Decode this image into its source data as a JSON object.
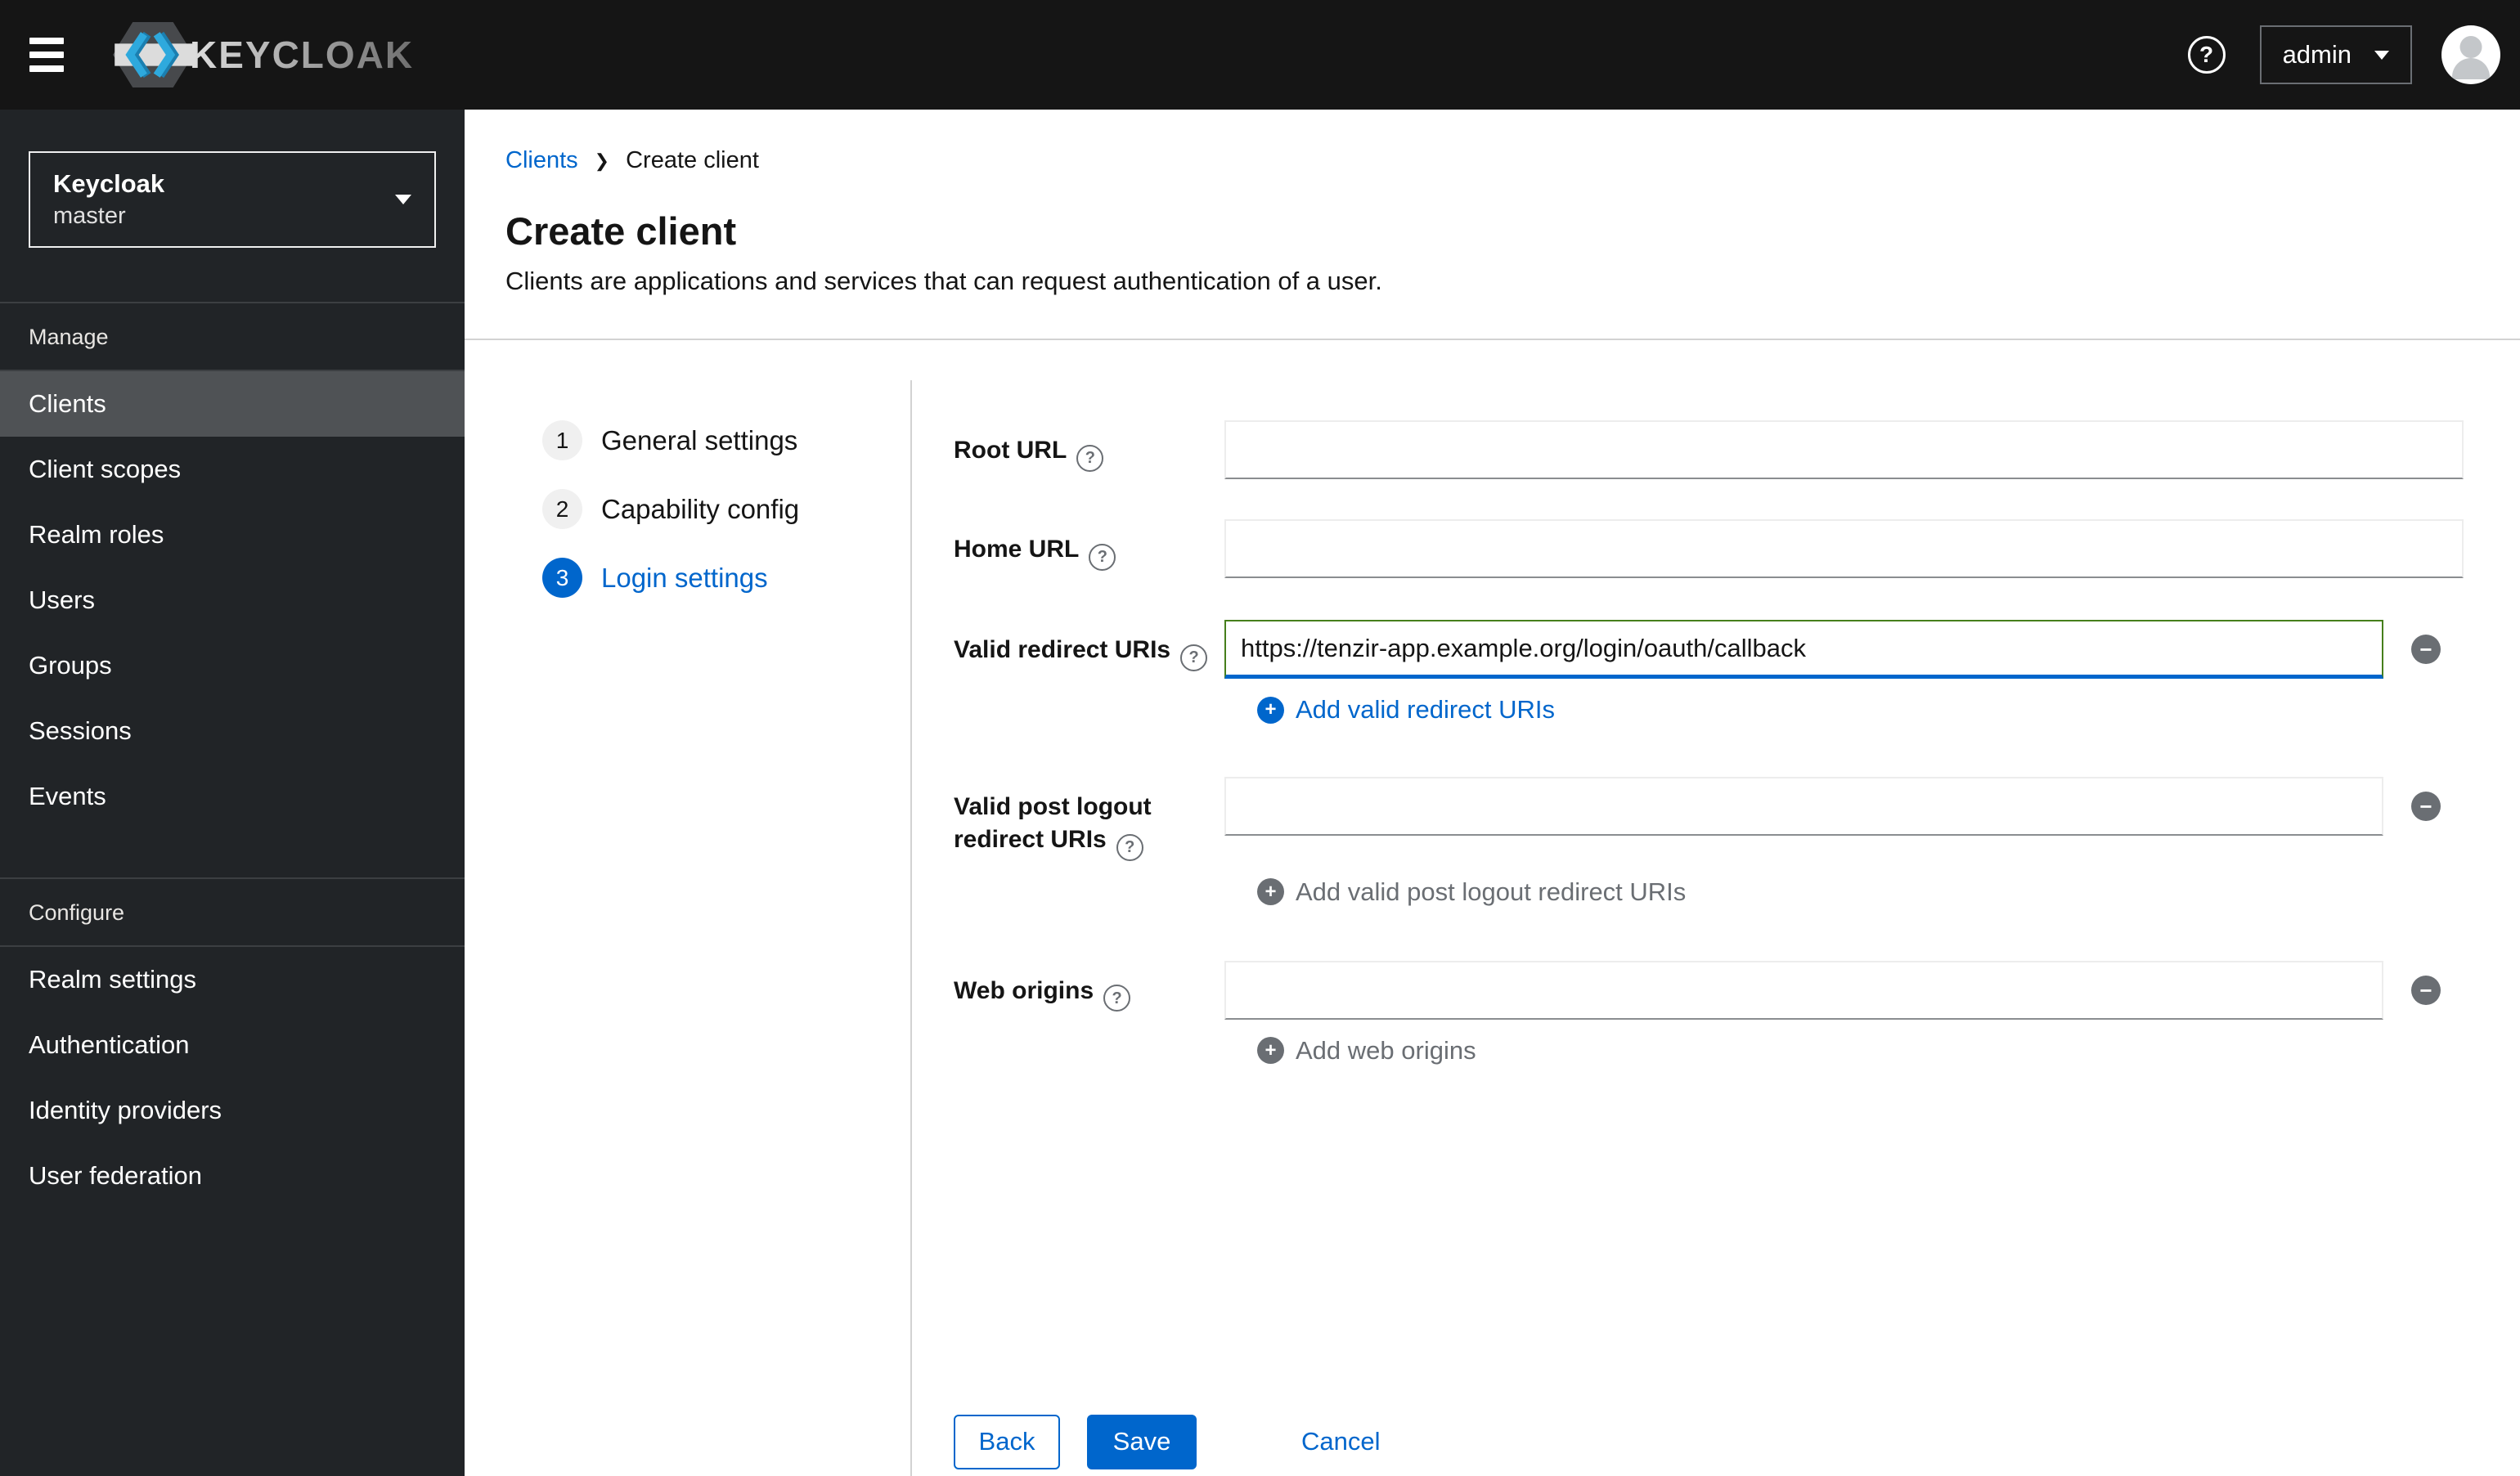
{
  "topbar": {
    "brand": "KEYCLOAK",
    "username": "admin"
  },
  "sidebar": {
    "realm": {
      "name": "Keycloak",
      "current": "master"
    },
    "sections": [
      {
        "label": "Manage",
        "items": [
          {
            "label": "Clients",
            "active": true
          },
          {
            "label": "Client scopes",
            "active": false
          },
          {
            "label": "Realm roles",
            "active": false
          },
          {
            "label": "Users",
            "active": false
          },
          {
            "label": "Groups",
            "active": false
          },
          {
            "label": "Sessions",
            "active": false
          },
          {
            "label": "Events",
            "active": false
          }
        ]
      },
      {
        "label": "Configure",
        "items": [
          {
            "label": "Realm settings",
            "active": false
          },
          {
            "label": "Authentication",
            "active": false
          },
          {
            "label": "Identity providers",
            "active": false
          },
          {
            "label": "User federation",
            "active": false
          }
        ]
      }
    ]
  },
  "breadcrumb": {
    "link": "Clients",
    "current": "Create client"
  },
  "page": {
    "title": "Create client",
    "subtitle": "Clients are applications and services that can request authentication of a user."
  },
  "wizard": {
    "steps": [
      {
        "num": "1",
        "label": "General settings",
        "active": false
      },
      {
        "num": "2",
        "label": "Capability config",
        "active": false
      },
      {
        "num": "3",
        "label": "Login settings",
        "active": true
      }
    ]
  },
  "form": {
    "fields": [
      {
        "label": "Root URL",
        "value": ""
      },
      {
        "label": "Home URL",
        "value": ""
      },
      {
        "label": "Valid redirect URIs",
        "value": "https://tenzir-app.example.org/login/oauth/callback",
        "add_label": "Add valid redirect URIs",
        "add_enabled": true
      },
      {
        "label": "Valid post logout redirect URIs",
        "value": "",
        "add_label": "Add valid post logout redirect URIs",
        "add_enabled": false
      },
      {
        "label": "Web origins",
        "value": "",
        "add_label": "Add web origins",
        "add_enabled": false
      }
    ],
    "buttons": {
      "back": "Back",
      "save": "Save",
      "cancel": "Cancel"
    }
  },
  "icons": {
    "help": "?",
    "add": "+",
    "remove": "−",
    "breadcrumb_divider": "❯"
  },
  "colors": {
    "primary": "#0066cc",
    "success_border": "#467f1c",
    "masthead_bg": "#151515",
    "sidebar_bg": "#212427",
    "sidebar_active_bg": "#4f5255",
    "divider": "#d2d2d2",
    "icon_gray": "#6a6e73"
  }
}
